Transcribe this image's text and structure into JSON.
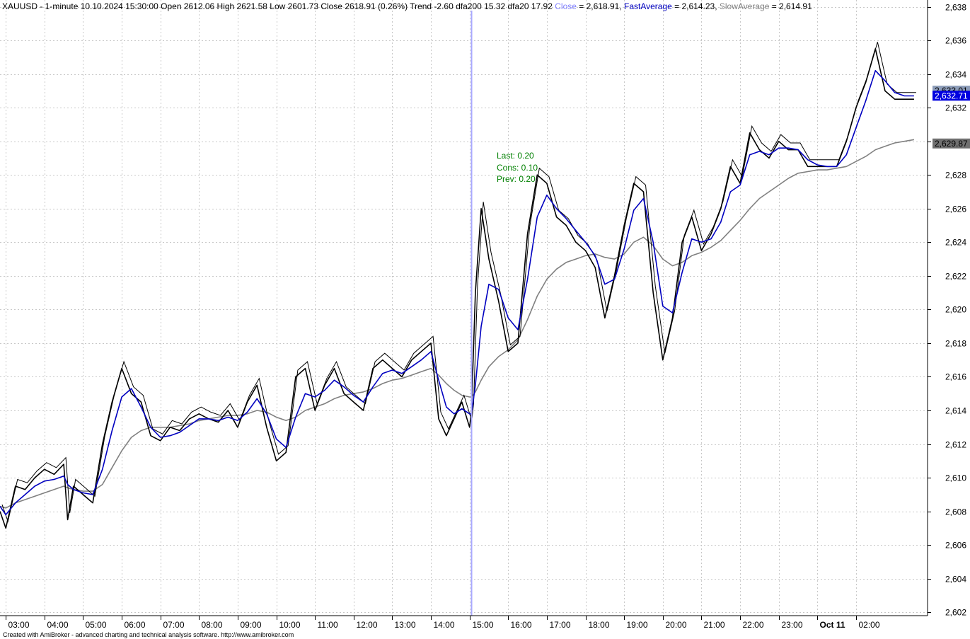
{
  "header": {
    "symbol": "XAUUSD",
    "info": " - 1-minute 10.10.2024 15:30:00 Open 2612.06 High 2621.58 Low 2601.73 Close 2618.91 (0.26%) Trend -2.60 dfa200 15.32 dfa20 17.92 ",
    "close_label": "Close",
    "close_value": " = 2,618.91, ",
    "fast_label": "FastAverage",
    "fast_value": " = 2,614.23, ",
    "slow_label": "SlowAverage",
    "slow_value": " = 2,614.91"
  },
  "footer": {
    "credit": "Created with AmiBroker - advanced charting and technical analysis software. http://www.amibroker.com"
  },
  "annotation": {
    "last": "Last: 0.20",
    "cons": "Cons: 0.10",
    "prev": "Prev: 0.20"
  },
  "colors": {
    "price": "#000000",
    "fast": "#0000c0",
    "slow": "#808080",
    "cursor": "#a8a8ff",
    "cursor_dark": "#2020a0",
    "grid": "#c8c8c8",
    "close_label": "#8080ff",
    "fast_label": "#0000c0",
    "slow_label": "#808080",
    "annotation": "#008000"
  },
  "chart_data": {
    "type": "line",
    "x_ticks": [
      "03:00",
      "04:00",
      "05:00",
      "06:00",
      "07:00",
      "08:00",
      "09:00",
      "10:00",
      "11:00",
      "12:00",
      "13:00",
      "14:00",
      "15:00",
      "16:00",
      "17:00",
      "18:00",
      "19:00",
      "20:00",
      "21:00",
      "22:00",
      "23:00",
      "Oct 11",
      "02:00"
    ],
    "x_tick_bold": "Oct 11",
    "y_ticks": [
      "2,602",
      "2,604",
      "2,606",
      "2,608",
      "2,610",
      "2,612",
      "2,614",
      "2,616",
      "2,618",
      "2,620",
      "2,622",
      "2,624",
      "2,626",
      "2,628",
      "2,630",
      "2,632",
      "2,634",
      "2,636",
      "2,638"
    ],
    "ylim": [
      2601.8,
      2638.4
    ],
    "xlim": [
      2.85,
      26.85
    ],
    "x": [
      2.85,
      3.0,
      3.25,
      3.5,
      3.75,
      4.0,
      4.25,
      4.5,
      4.6,
      4.75,
      5.0,
      5.25,
      5.5,
      5.75,
      6.0,
      6.25,
      6.5,
      6.75,
      7.0,
      7.25,
      7.5,
      7.75,
      8.0,
      8.25,
      8.5,
      8.75,
      9.0,
      9.25,
      9.5,
      9.75,
      10.0,
      10.25,
      10.5,
      10.75,
      11.0,
      11.25,
      11.5,
      11.75,
      12.0,
      12.25,
      12.5,
      12.75,
      13.0,
      13.25,
      13.5,
      13.75,
      14.0,
      14.2,
      14.4,
      14.6,
      14.8,
      15.0,
      15.05,
      15.15,
      15.3,
      15.5,
      15.75,
      16.0,
      16.25,
      16.5,
      16.75,
      17.0,
      17.25,
      17.5,
      17.75,
      18.0,
      18.25,
      18.5,
      18.75,
      19.0,
      19.25,
      19.5,
      19.75,
      20.0,
      20.25,
      20.5,
      20.75,
      21.0,
      21.25,
      21.5,
      21.75,
      22.0,
      22.25,
      22.5,
      22.75,
      23.0,
      23.25,
      23.5,
      23.75,
      24.0,
      24.25,
      24.5,
      24.75,
      25.0,
      25.25,
      25.5,
      25.75,
      26.0,
      26.25,
      26.5,
      26.7,
      26.85
    ],
    "series": [
      {
        "name": "Close",
        "values": [
          2608.0,
          2607.0,
          2609.5,
          2609.3,
          2610.0,
          2610.5,
          2610.2,
          2610.8,
          2607.5,
          2609.5,
          2609.0,
          2608.5,
          2612.0,
          2614.5,
          2616.5,
          2615.0,
          2614.5,
          2612.5,
          2612.2,
          2613.0,
          2612.8,
          2613.5,
          2613.8,
          2613.5,
          2613.3,
          2614.0,
          2613.0,
          2614.5,
          2615.5,
          2613.0,
          2611.0,
          2611.5,
          2616.0,
          2616.5,
          2614.0,
          2615.5,
          2616.5,
          2615.0,
          2614.5,
          2614.0,
          2616.5,
          2617.0,
          2616.5,
          2616.0,
          2617.0,
          2617.5,
          2618.0,
          2613.5,
          2612.5,
          2613.5,
          2614.5,
          2613.0,
          2614.0,
          2621.0,
          2626.0,
          2623.0,
          2620.5,
          2617.5,
          2618.0,
          2624.5,
          2628.0,
          2627.5,
          2625.5,
          2625.0,
          2624.0,
          2623.5,
          2622.5,
          2619.5,
          2622.0,
          2625.0,
          2627.5,
          2627.0,
          2621.0,
          2617.0,
          2619.5,
          2624.0,
          2625.5,
          2623.5,
          2624.5,
          2626.0,
          2628.5,
          2627.5,
          2630.5,
          2629.5,
          2629.0,
          2630.0,
          2629.5,
          2629.5,
          2628.5,
          2628.5,
          2628.5,
          2628.5,
          2630.0,
          2632.0,
          2633.5,
          2635.5,
          2633.0,
          2632.5,
          2632.5,
          2632.5
        ],
        "color": "#000000"
      },
      {
        "name": "FastAverage",
        "values": [
          2608.3,
          2607.8,
          2608.5,
          2609.0,
          2609.5,
          2609.8,
          2609.9,
          2610.1,
          2609.6,
          2609.3,
          2609.1,
          2609.0,
          2610.5,
          2612.8,
          2614.8,
          2615.3,
          2614.2,
          2613.0,
          2612.4,
          2612.5,
          2612.7,
          2613.1,
          2613.5,
          2613.5,
          2613.4,
          2613.6,
          2613.4,
          2613.9,
          2614.7,
          2613.8,
          2612.3,
          2611.8,
          2613.6,
          2615.0,
          2614.8,
          2615.2,
          2615.8,
          2615.4,
          2614.9,
          2614.5,
          2615.4,
          2616.2,
          2616.4,
          2616.2,
          2616.6,
          2617.0,
          2617.5,
          2615.8,
          2614.2,
          2613.8,
          2614.1,
          2613.8,
          2613.8,
          2615.5,
          2619.0,
          2621.5,
          2621.2,
          2619.5,
          2618.8,
          2621.8,
          2625.5,
          2626.8,
          2626.0,
          2625.4,
          2624.7,
          2624.0,
          2623.2,
          2621.5,
          2621.8,
          2623.6,
          2625.9,
          2626.6,
          2624.0,
          2620.2,
          2619.8,
          2622.2,
          2624.2,
          2624.0,
          2624.2,
          2625.2,
          2627.0,
          2627.4,
          2629.2,
          2629.4,
          2629.2,
          2629.6,
          2629.6,
          2629.5,
          2628.9,
          2628.6,
          2628.5,
          2628.5,
          2629.2,
          2630.8,
          2632.4,
          2634.2,
          2633.6,
          2632.9,
          2632.7,
          2632.7
        ],
        "color": "#0000c0"
      },
      {
        "name": "SlowAverage",
        "values": [
          2608.3,
          2608.2,
          2608.5,
          2608.7,
          2608.9,
          2609.1,
          2609.3,
          2609.5,
          2609.4,
          2609.3,
          2609.2,
          2609.2,
          2609.6,
          2610.6,
          2611.6,
          2612.4,
          2612.8,
          2613.0,
          2613.0,
          2613.0,
          2613.1,
          2613.2,
          2613.4,
          2613.5,
          2613.6,
          2613.7,
          2613.7,
          2613.8,
          2614.0,
          2613.9,
          2613.6,
          2613.4,
          2613.6,
          2614.0,
          2614.2,
          2614.4,
          2614.7,
          2614.9,
          2615.0,
          2615.1,
          2615.3,
          2615.6,
          2615.8,
          2615.9,
          2616.1,
          2616.3,
          2616.5,
          2616.1,
          2615.6,
          2615.2,
          2614.9,
          2614.8,
          2614.8,
          2615.1,
          2615.8,
          2616.6,
          2617.2,
          2617.6,
          2618.2,
          2619.4,
          2620.8,
          2621.8,
          2622.4,
          2622.8,
          2623.0,
          2623.2,
          2623.3,
          2623.1,
          2623.0,
          2623.3,
          2624.0,
          2624.3,
          2623.8,
          2623.0,
          2622.6,
          2622.8,
          2623.2,
          2623.4,
          2623.7,
          2624.1,
          2624.7,
          2625.3,
          2626.0,
          2626.6,
          2627.0,
          2627.4,
          2627.8,
          2628.1,
          2628.2,
          2628.3,
          2628.3,
          2628.4,
          2628.5,
          2628.8,
          2629.1,
          2629.5,
          2629.7,
          2629.9,
          2630.0,
          2630.1
        ],
        "color": "#808080"
      }
    ],
    "cursor_x": 15.05,
    "price_labels": [
      {
        "value": 2633.01,
        "text": "2,633.01",
        "bg": "#8c9cb8",
        "fg": "#000000"
      },
      {
        "value": 2632.71,
        "text": "2,632.71",
        "bg": "#0000e0",
        "fg": "#ffffff"
      },
      {
        "value": 2629.87,
        "text": "2,629.87",
        "bg": "#707070",
        "fg": "#000000"
      }
    ]
  }
}
